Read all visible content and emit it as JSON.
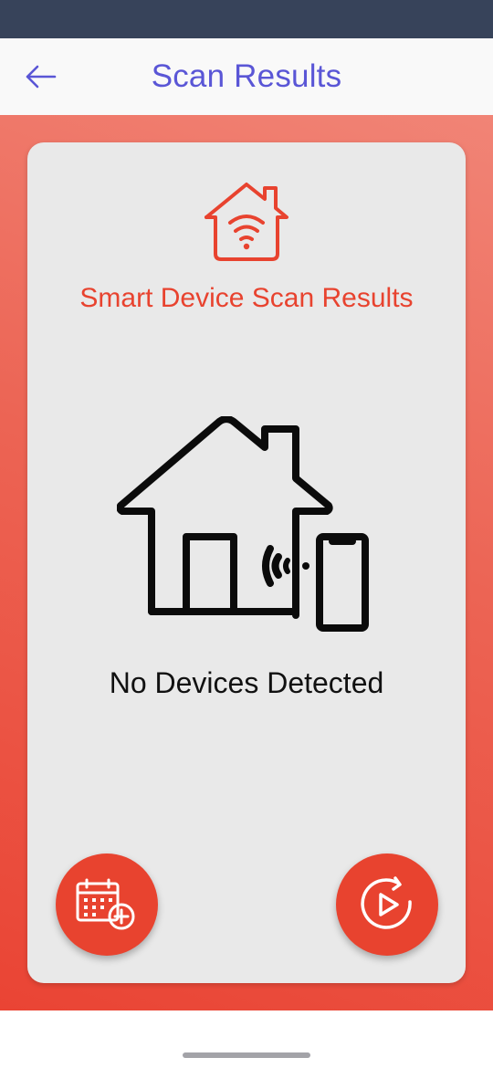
{
  "app_bar": {
    "title": "Scan Results",
    "back_icon": "arrow-left-icon",
    "title_color": "#5a56d6"
  },
  "card": {
    "header_icon": "smart-home-wifi-icon",
    "title": "Smart Device Scan Results",
    "illustration": "house-with-phone-signal-illustration",
    "empty_message": "No Devices Detected",
    "accent_color": "#e8432f"
  },
  "actions": {
    "schedule_icon": "calendar-add-icon",
    "rescan_icon": "replay-play-icon"
  },
  "colors": {
    "status_bar": "#37435a",
    "background_gradient_start": "#f18476",
    "background_gradient_end": "#ea4434",
    "card": "#e9e9e9"
  }
}
